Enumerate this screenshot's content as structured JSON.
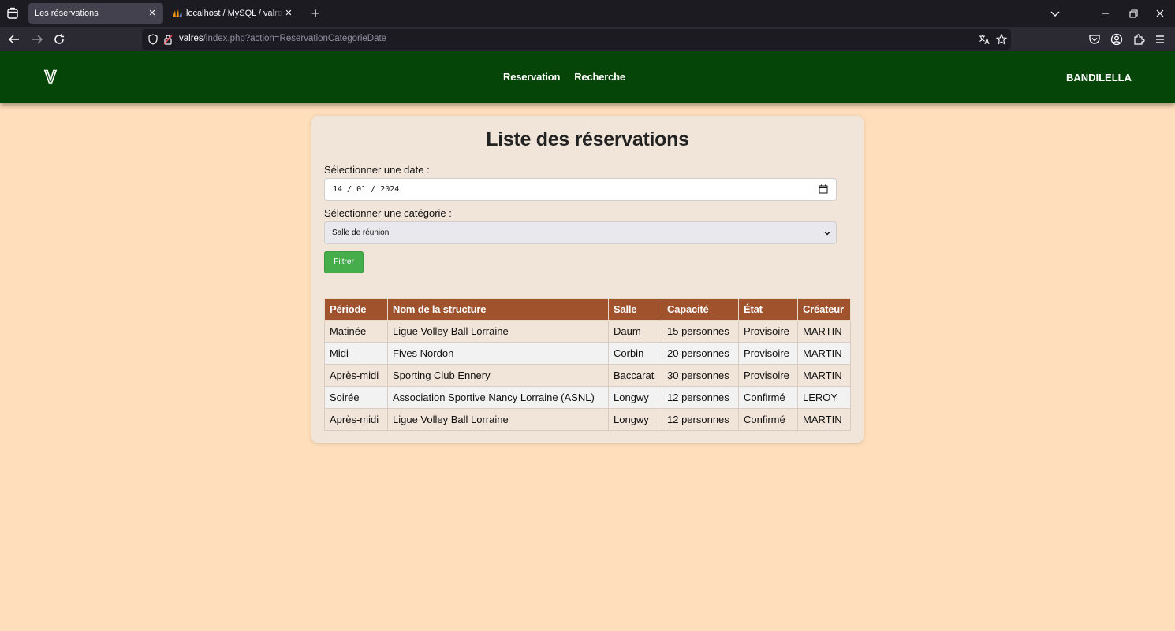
{
  "browser": {
    "tabs": [
      {
        "title": "Les réservations",
        "active": true
      },
      {
        "title": "localhost / MySQL / valres / uti",
        "active": false
      }
    ],
    "url_host": "valres",
    "url_path": "/index.php?action=ReservationCategorieDate"
  },
  "header": {
    "logo_letter": "V",
    "menu": [
      {
        "label": "Reservation"
      },
      {
        "label": "Recherche"
      }
    ],
    "user": "BANDILELLA"
  },
  "page": {
    "title": "Liste des réservations",
    "date_label": "Sélectionner une date :",
    "date_value": "14 / 01 / 2024",
    "category_label": "Sélectionner une catégorie :",
    "category_value": "Salle de réunion",
    "filter_button": "Filtrer"
  },
  "table": {
    "headers": [
      "Période",
      "Nom de la structure",
      "Salle",
      "Capacité",
      "État",
      "Créateur"
    ],
    "rows": [
      [
        "Matinée",
        "Ligue Volley Ball Lorraine",
        "Daum",
        "15 personnes",
        "Provisoire",
        "MARTIN"
      ],
      [
        "Midi",
        "Fives Nordon",
        "Corbin",
        "20 personnes",
        "Provisoire",
        "MARTIN"
      ],
      [
        "Après-midi",
        "Sporting Club Ennery",
        "Baccarat",
        "30 personnes",
        "Provisoire",
        "MARTIN"
      ],
      [
        "Soirée",
        "Association Sportive Nancy Lorraine (ASNL)",
        "Longwy",
        "12 personnes",
        "Confirmé",
        "LEROY"
      ],
      [
        "Après-midi",
        "Ligue Volley Ball Lorraine",
        "Longwy",
        "12 personnes",
        "Confirmé",
        "MARTIN"
      ]
    ]
  },
  "colors": {
    "header_bg": "#064508",
    "page_bg": "#ffdfbb",
    "card_bg": "#f1e4d9",
    "table_header_bg": "#a0522d",
    "button_bg": "#46ad4b"
  }
}
